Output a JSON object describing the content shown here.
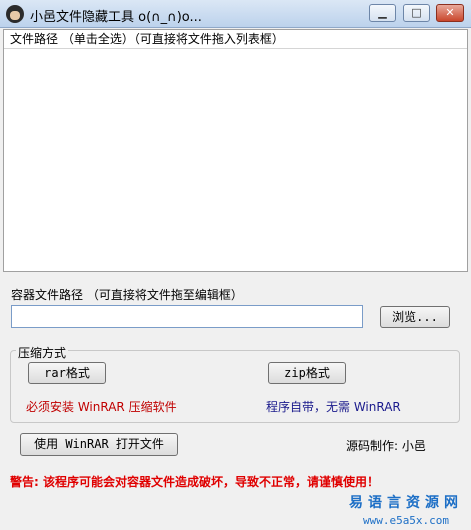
{
  "window": {
    "title": "小邑文件隐藏工具 o(∩_∩)o..."
  },
  "file_list": {
    "header": "文件路径 （单击全选）（可直接将文件拖入列表框）"
  },
  "container": {
    "label": "容器文件路径  （可直接将文件拖至编辑框）",
    "path_value": "",
    "browse_label": "浏览..."
  },
  "compression": {
    "title": "压缩方式",
    "rar_label": "rar格式",
    "zip_label": "zip格式",
    "rar_note": "必须安装 WinRAR 压缩软件",
    "zip_note": "程序自带，无需 WinRAR"
  },
  "open_with_winrar_label": "使用 WinRAR 打开文件",
  "author": "源码制作: 小邑",
  "warning": "警告: 该程序可能会对容器文件造成破坏，导致不正常，请谨慎使用！",
  "watermark": {
    "cn": "易语言资源网",
    "en": "www.e5a5x.com"
  },
  "colors": {
    "warning": "#e00000",
    "rar_note": "#c00000",
    "zip_note": "#1a1a8c",
    "watermark": "#1d6fc6"
  }
}
